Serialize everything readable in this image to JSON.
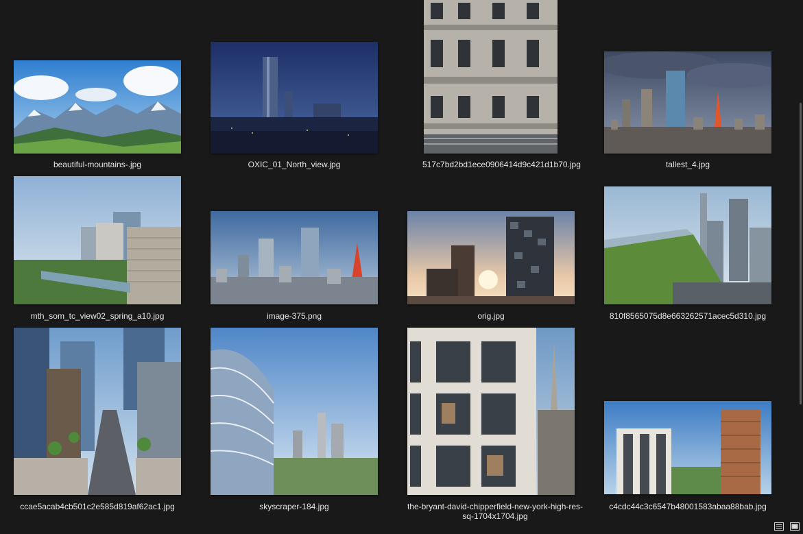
{
  "window": {
    "background": "#191919"
  },
  "files": [
    {
      "name": "beautiful-mountains-.jpg",
      "icon": "mountain-landscape-image"
    },
    {
      "name": "OXIC_01_North_view.jpg",
      "icon": "city-night-tower-image"
    },
    {
      "name": "517c7bd2bd1ece0906414d9c421d1b70.jpg",
      "icon": "building-facade-image"
    },
    {
      "name": "tallest_4.jpg",
      "icon": "tokyo-skyline-image"
    },
    {
      "name": "mth_som_tc_view02_spring_a10.jpg",
      "icon": "riverside-towers-image"
    },
    {
      "name": "image-375.png",
      "icon": "tokyo-aerial-image"
    },
    {
      "name": "orig.jpg",
      "icon": "twin-towers-sunset-image"
    },
    {
      "name": "810f8565075d8e663262571acec5d310.jpg",
      "icon": "park-skyline-aerial-image"
    },
    {
      "name": "ccae5acab4cb501c2e585d819af62ac1.jpg",
      "icon": "street-towers-image"
    },
    {
      "name": "skyscraper-184.jpg",
      "icon": "glass-skyscraper-image"
    },
    {
      "name": "the-bryant-david-chipperfield-new-york-high-res-sq-1704x1704.jpg",
      "icon": "apartment-empire-state-image"
    },
    {
      "name": "c4cdc44c3c6547b48001583abaa88bab.jpg",
      "icon": "residential-towers-image"
    }
  ],
  "statusbar": {
    "details_view_icon": "details-view-icon",
    "large_icons_view_icon": "large-icons-view-icon"
  }
}
